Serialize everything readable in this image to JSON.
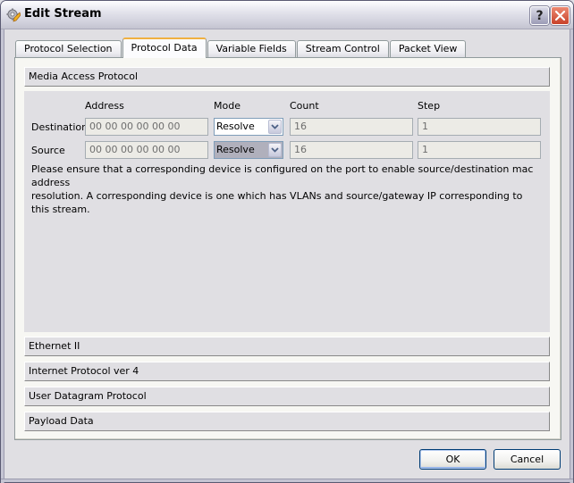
{
  "window": {
    "title": "Edit Stream",
    "icon": "gear-pencil-icon",
    "help_button": "?",
    "close_button": "close-icon"
  },
  "tabs": [
    {
      "label": "Protocol Selection",
      "active": false
    },
    {
      "label": "Protocol Data",
      "active": true
    },
    {
      "label": "Variable Fields",
      "active": false
    },
    {
      "label": "Stream Control",
      "active": false
    },
    {
      "label": "Packet View",
      "active": false
    }
  ],
  "mac_section": {
    "header": "Media Access Protocol",
    "columns": [
      "Address",
      "Mode",
      "Count",
      "Step"
    ],
    "rows": [
      {
        "label": "Destination",
        "address": "00 00 00 00 00 00",
        "mode": "Resolve",
        "count": "16",
        "step": "1"
      },
      {
        "label": "Source",
        "address": "00 00 00 00 00 00",
        "mode": "Resolve",
        "count": "16",
        "step": "1"
      }
    ],
    "note_line1": "Please ensure that a corresponding device is configured on the port to enable source/destination mac address",
    "note_line2": "resolution. A corresponding device is one which has VLANs and source/gateway IP corresponding to this stream."
  },
  "collapsed_sections": [
    "Ethernet II",
    "Internet Protocol ver 4",
    "User Datagram Protocol",
    "Payload Data"
  ],
  "buttons": {
    "ok": "OK",
    "cancel": "Cancel"
  },
  "colors": {
    "active_tab_accent": "#f0b040",
    "close_button": "#c8412a",
    "dialog_bg": "#e0dfe3"
  }
}
